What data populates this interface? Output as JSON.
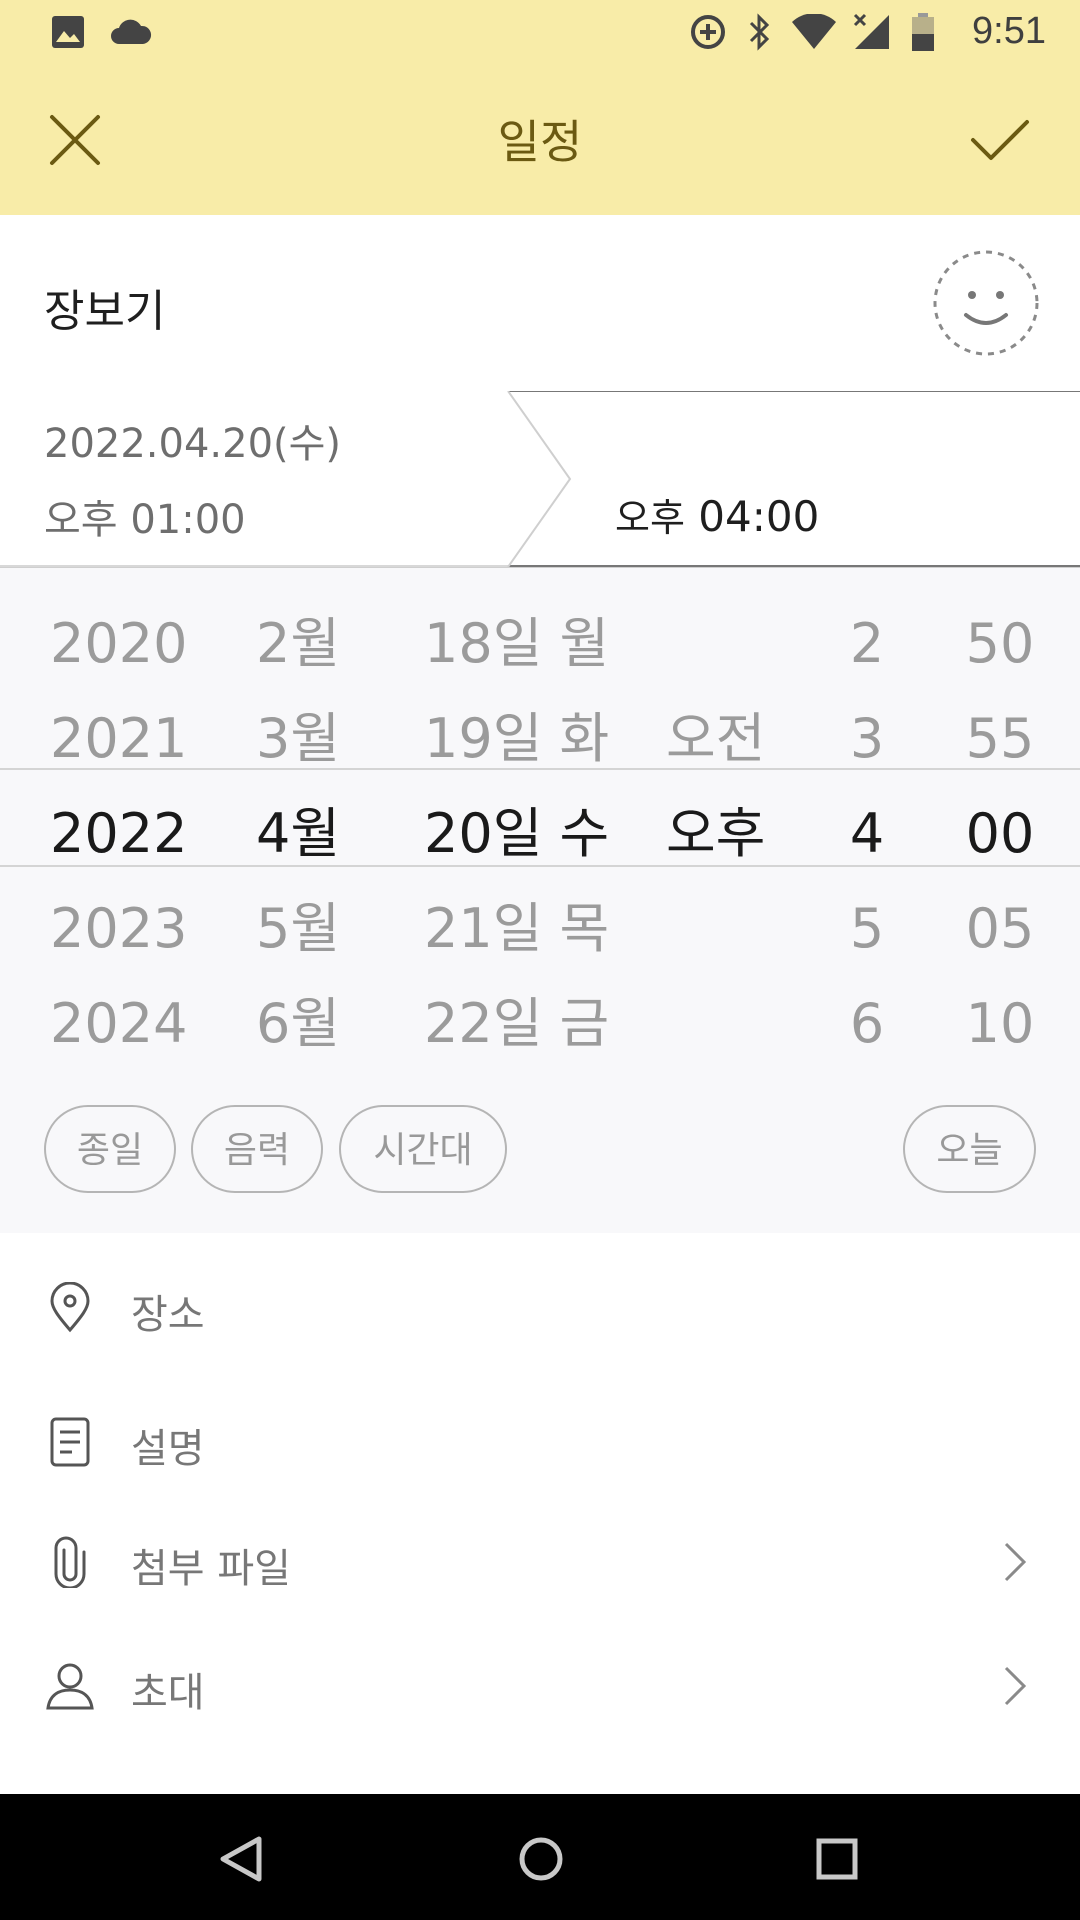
{
  "status_bar": {
    "time": "9:51",
    "icons": [
      "image-icon",
      "cloud-icon",
      "sync-add-icon",
      "bluetooth-icon",
      "wifi-icon",
      "cellular-no-signal-icon",
      "battery-icon"
    ]
  },
  "app_bar": {
    "title": "일정",
    "close_icon": "close-icon",
    "confirm_icon": "check-icon"
  },
  "event": {
    "title": "장보기",
    "emoji_icon": "smiley-placeholder-icon"
  },
  "range": {
    "start_date": "2022.04.20(수)",
    "start_time": "오후 01:00",
    "end_time_prefix": "오후",
    "end_time": "04:00"
  },
  "picker": {
    "years": [
      "2020",
      "2021",
      "2022",
      "2023",
      "2024"
    ],
    "months": [
      "2월",
      "3월",
      "4월",
      "5월",
      "6월"
    ],
    "days": [
      "18일 월",
      "19일 화",
      "20일 수",
      "21일 목",
      "22일 금"
    ],
    "ampm": [
      "",
      "오전",
      "오후",
      "",
      ""
    ],
    "hours": [
      "2",
      "3",
      "4",
      "5",
      "6"
    ],
    "minutes": [
      "50",
      "55",
      "00",
      "05",
      "10"
    ],
    "selected_index": 2
  },
  "chips": {
    "all_day": "종일",
    "lunar": "음력",
    "timezone": "시간대",
    "today": "오늘"
  },
  "rows": {
    "location": "장소",
    "description": "설명",
    "attachment": "첨부 파일",
    "invite": "초대"
  },
  "nav_bar": {
    "back_icon": "back-triangle-icon",
    "home_icon": "home-circle-icon",
    "recents_icon": "recents-square-icon"
  }
}
